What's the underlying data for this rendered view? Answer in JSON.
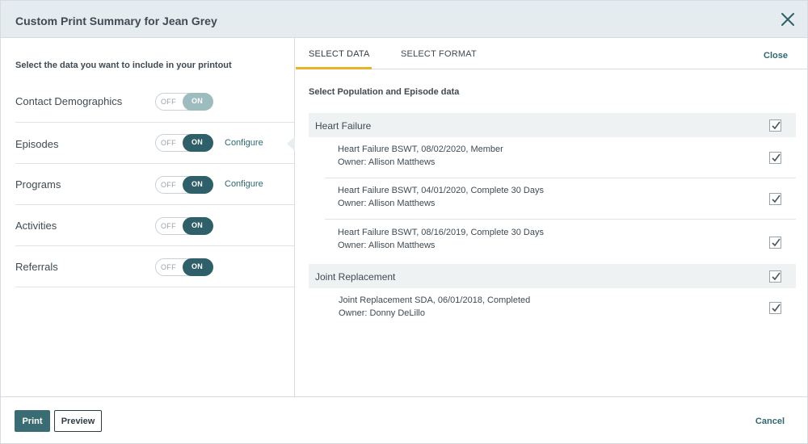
{
  "dialog": {
    "title": "Custom Print Summary for Jean Grey"
  },
  "left_panel": {
    "instructions": "Select the data you want to include in your printout",
    "rows": [
      {
        "label": "Contact Demographics",
        "toggle": "on",
        "configure": ""
      },
      {
        "label": "Episodes",
        "toggle": "on",
        "configure": "Configure"
      },
      {
        "label": "Programs",
        "toggle": "on",
        "configure": "Configure"
      },
      {
        "label": "Activities",
        "toggle": "on",
        "configure": ""
      },
      {
        "label": "Referrals",
        "toggle": "on",
        "configure": ""
      }
    ],
    "toggle_off_label": "OFF",
    "toggle_on_label": "ON"
  },
  "right_panel": {
    "tabs": [
      {
        "label": "SELECT DATA",
        "active": true
      },
      {
        "label": "SELECT FORMAT",
        "active": false
      }
    ],
    "close_label": "Close",
    "section_title": "Select Population and Episode data",
    "groups": [
      {
        "label": "Heart Failure",
        "checked": true,
        "items": [
          {
            "line1": "Heart Failure BSWT,  08/02/2020, Member",
            "line2": "Owner: Allison Matthews",
            "checked": true
          },
          {
            "line1": "Heart Failure BSWT,  04/01/2020, Complete 30 Days",
            "line2": "Owner: Allison Matthews",
            "checked": true
          },
          {
            "line1": "Heart Failure BSWT,  08/16/2019, Complete 30 Days",
            "line2": "Owner: Allison Matthews",
            "checked": true
          }
        ]
      },
      {
        "label": "Joint Replacement",
        "checked": true,
        "items": [
          {
            "line1": "Joint Replacement SDA, 06/01/2018, Completed",
            "line2": "Owner: Donny DeLillo",
            "checked": true
          }
        ]
      }
    ]
  },
  "footer": {
    "print_label": "Print",
    "preview_label": "Preview",
    "cancel_label": "Cancel"
  },
  "colors": {
    "accent": "#2f5f68",
    "tab_underline": "#e7b429",
    "header_bg": "#e5ecef"
  },
  "icons": {
    "close": "close-icon",
    "checkbox": "checkmark-icon"
  }
}
